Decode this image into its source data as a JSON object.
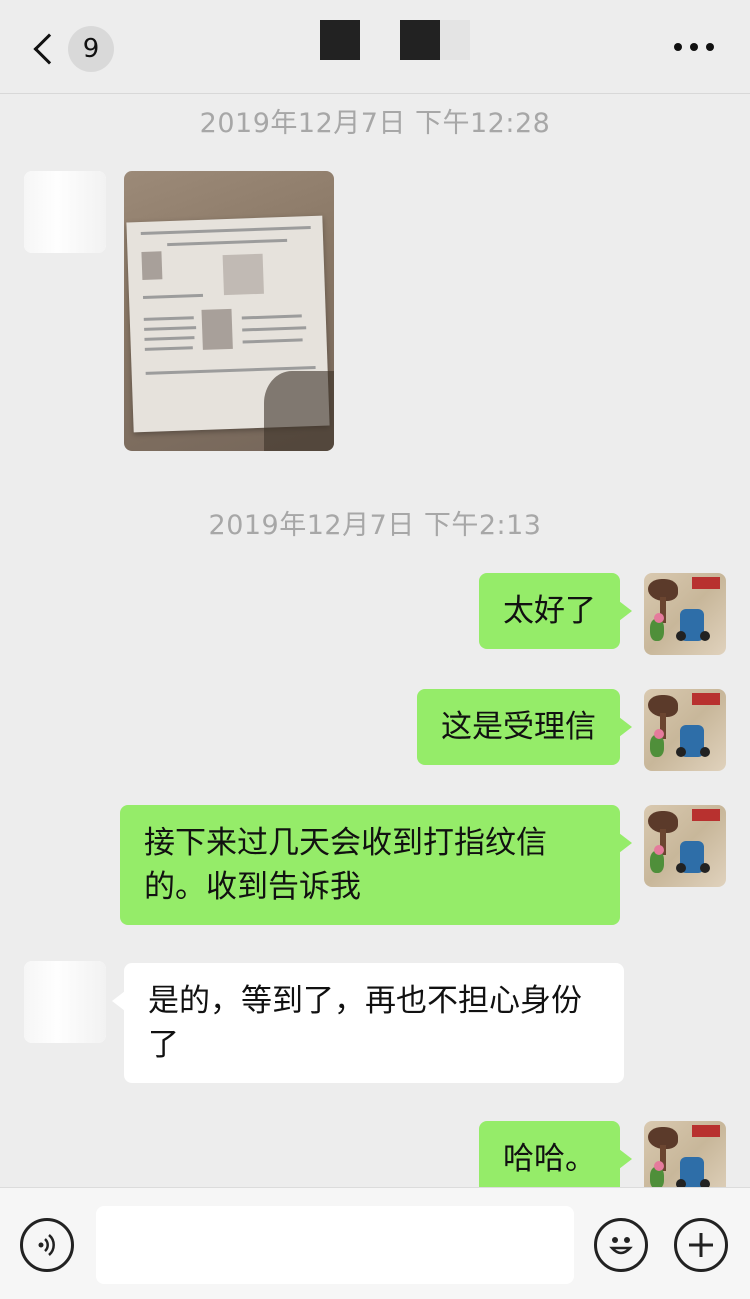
{
  "header": {
    "back_label": "",
    "unread_count": "9"
  },
  "timestamps": [
    "2019年12月7日 下午12:28",
    "2019年12月7日 下午2:13"
  ],
  "messages": [
    {
      "side": "left",
      "type": "image"
    },
    {
      "side": "right",
      "text": "太好了"
    },
    {
      "side": "right",
      "text": "这是受理信"
    },
    {
      "side": "right",
      "text": "接下来过几天会收到打指纹信的。收到告诉我"
    },
    {
      "side": "left",
      "text": "是的，等到了，再也不担心身份了"
    },
    {
      "side": "right",
      "text": "哈哈。"
    }
  ],
  "input_bar": {
    "voice_icon": "voice-icon",
    "emoji_icon": "emoji-icon",
    "plus_icon": "plus-icon",
    "message_value": ""
  },
  "colors": {
    "background": "#ededed",
    "sent_bubble": "#95ec69",
    "received_bubble": "#ffffff",
    "timestamp": "#a7a7a7"
  }
}
